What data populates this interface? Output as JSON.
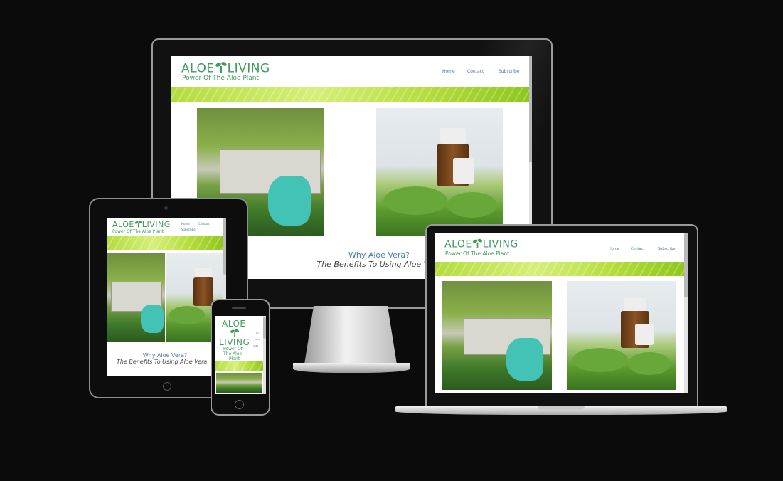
{
  "site": {
    "logo_part1": "ALOE",
    "logo_part2": "LIVING",
    "tagline": "Power Of The Aloe Plant",
    "nav": [
      "Home",
      "Contact",
      "Subscribe"
    ],
    "heading": "Why Aloe Vera?",
    "subheading": "The Benefits To Using Aloe Vera"
  },
  "phone": {
    "logo_part1": "ALOE",
    "logo_part2": "LIVING",
    "tagline_line1": "Power Of",
    "tagline_line2": "The Aloe",
    "tagline_line3": "Plant",
    "nav_home": "Ho",
    "nav_contact": "Conti",
    "nav_subscribe": "Subs"
  },
  "colors": {
    "background": "#0b0b0b",
    "brand_green": "#3f9a5c",
    "nav_blue": "#4a7aa8",
    "banner_green": "#b4dc3c"
  },
  "icons": [
    "sprout-icon"
  ]
}
